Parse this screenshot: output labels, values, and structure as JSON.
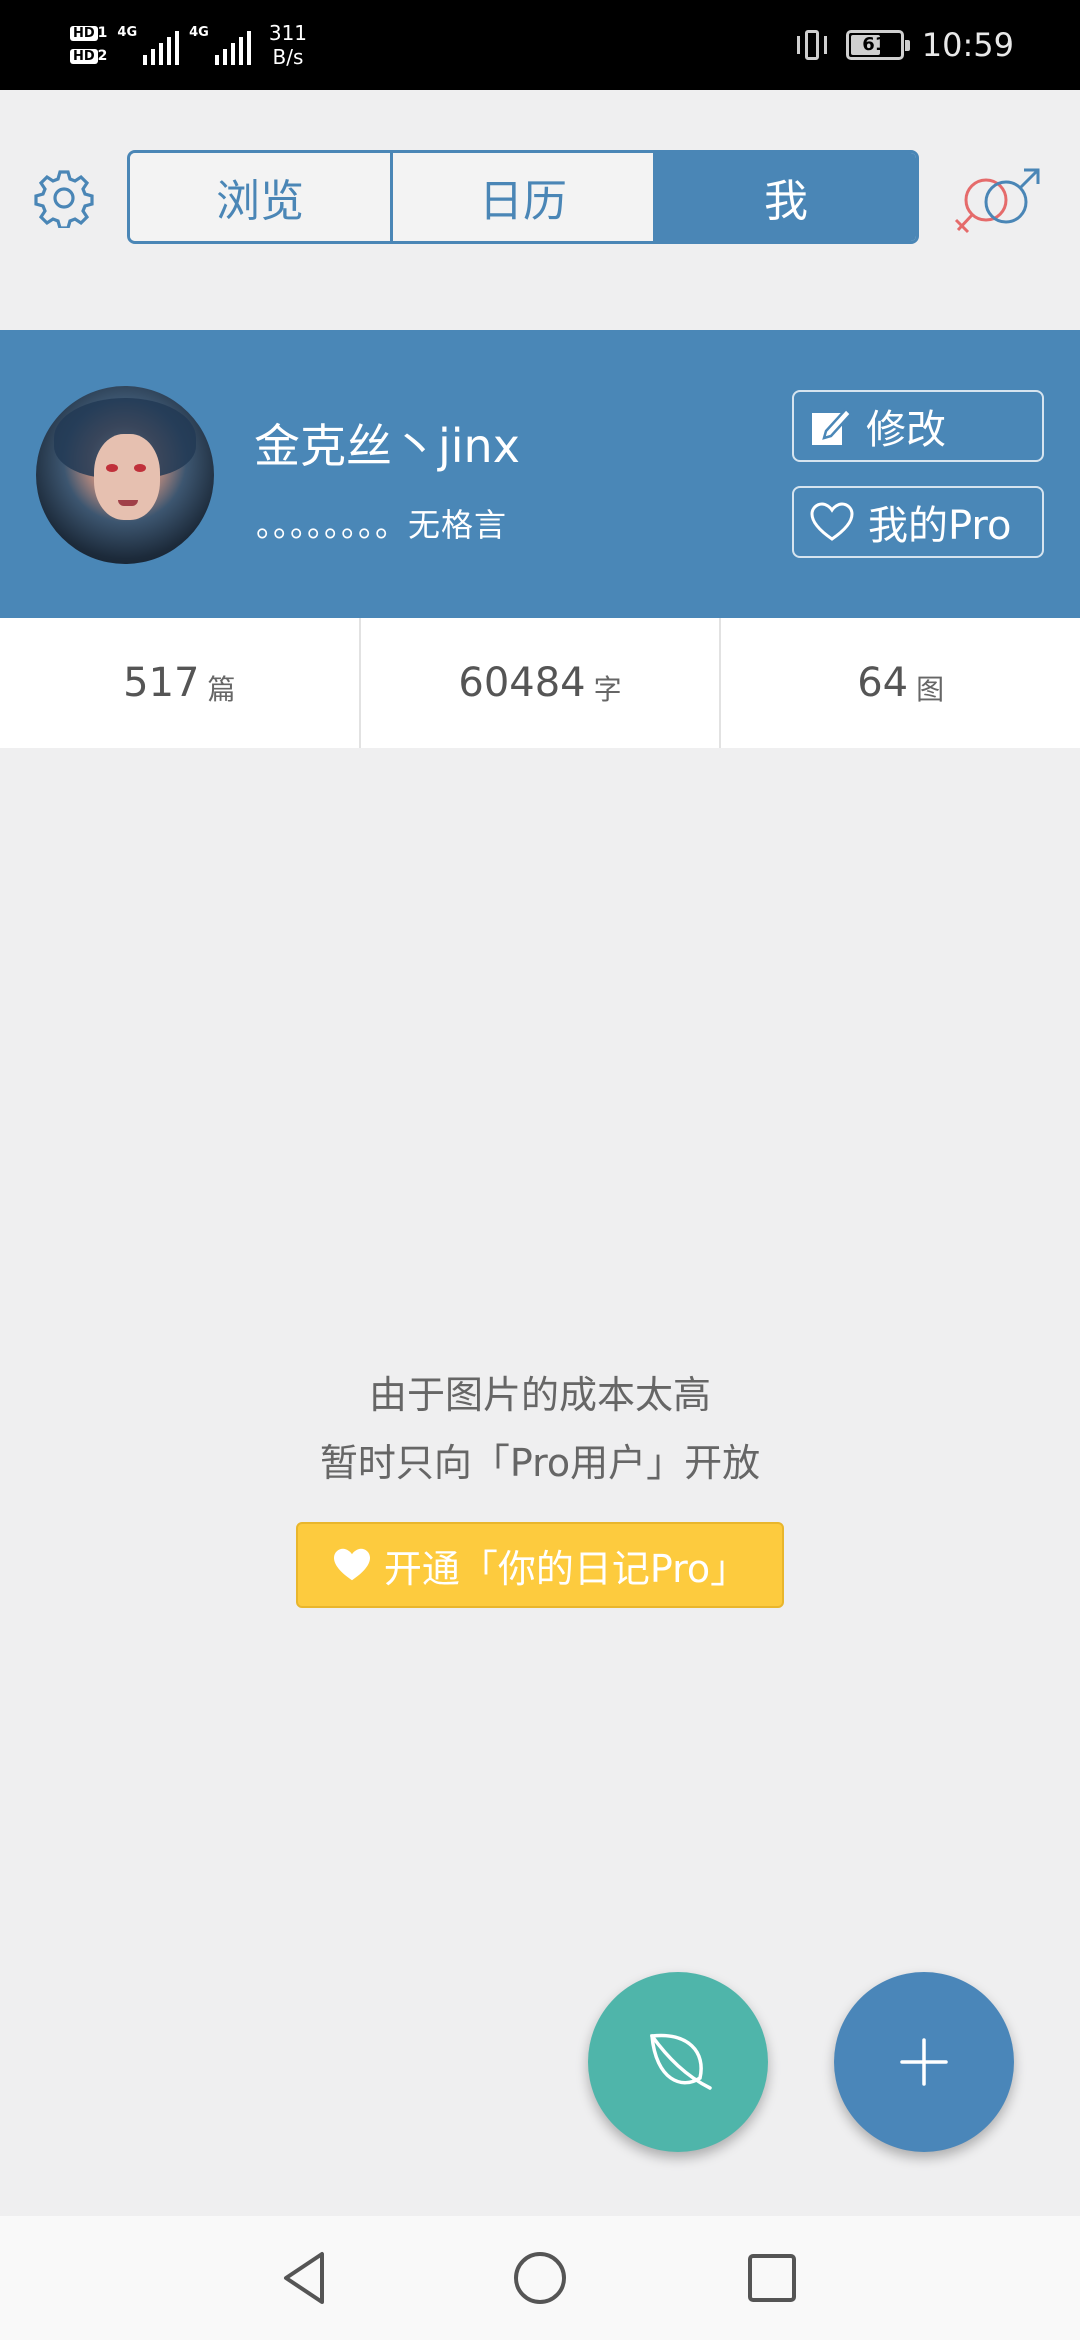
{
  "status_bar": {
    "hd1": "HD",
    "hd1_sub": "1",
    "hd2": "HD",
    "hd2_sub": "2",
    "signal1_label": "4G",
    "signal2_label": "4G",
    "net_speed_value": "311",
    "net_speed_unit": "B/s",
    "battery_level": "61",
    "time": "10:59"
  },
  "header": {
    "settings_icon": "gear-icon",
    "tabs": [
      {
        "label": "浏览",
        "active": false
      },
      {
        "label": "日历",
        "active": false
      },
      {
        "label": "我",
        "active": true
      }
    ],
    "gender_icon": "gender-symbol-icon"
  },
  "profile": {
    "name": "金克丝丶jinx",
    "motto": "。。。。。。。。无格言",
    "edit_label": "修改",
    "pro_label": "我的Pro"
  },
  "stats": [
    {
      "value": "517",
      "unit": "篇"
    },
    {
      "value": "60484",
      "unit": "字"
    },
    {
      "value": "64",
      "unit": "图"
    }
  ],
  "message": {
    "line1": "由于图片的成本太高",
    "line2": "暂时只向「Pro用户」开放",
    "button_label": "开通「你的日记Pro」"
  },
  "fabs": {
    "leaf_icon": "leaf-icon",
    "add_icon": "plus-icon"
  },
  "colors": {
    "primary": "#4a87b7",
    "teal": "#4fb5aa",
    "yellow": "#fdcb3e",
    "background": "#efeff0"
  }
}
